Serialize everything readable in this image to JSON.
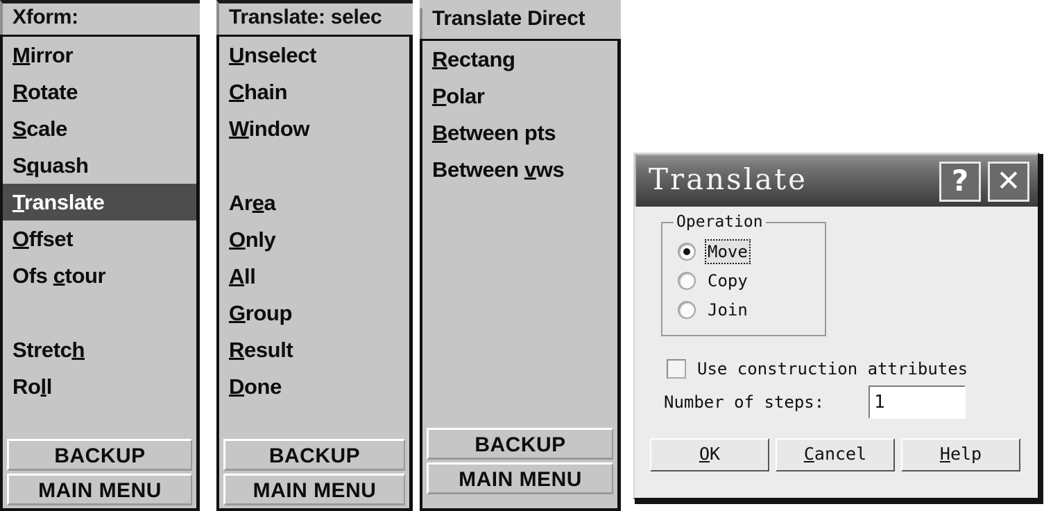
{
  "app": {
    "theme": {
      "panel_bg": "#c6c6c6",
      "panel_border": "#111111",
      "selection_bg": "#4d4d4d",
      "selection_fg": "#ffffff",
      "dialog_bg": "#ececec",
      "titlebar_dark": "#3b3b3b"
    }
  },
  "panels": [
    {
      "id": "xform-menu",
      "title": "Xform:",
      "items": [
        {
          "label": "Mirror",
          "pre": "",
          "accel": "M",
          "post": "irror",
          "selected": false
        },
        {
          "label": "Rotate",
          "pre": "",
          "accel": "R",
          "post": "otate",
          "selected": false
        },
        {
          "label": "Scale",
          "pre": "",
          "accel": "S",
          "post": "cale",
          "selected": false
        },
        {
          "label": "Squash",
          "pre": "S",
          "accel": "q",
          "post": "uash",
          "selected": false
        },
        {
          "label": "Translate",
          "pre": "",
          "accel": "T",
          "post": "ranslate",
          "selected": true
        },
        {
          "label": "Offset",
          "pre": "",
          "accel": "O",
          "post": "ffset",
          "selected": false
        },
        {
          "label": "Ofs ctour",
          "pre": "Ofs ",
          "accel": "c",
          "post": "tour",
          "selected": false
        },
        {
          "label": "",
          "spacer": true
        },
        {
          "label": "Stretch",
          "pre": "Stretc",
          "accel": "h",
          "post": "",
          "selected": false
        },
        {
          "label": "Roll",
          "pre": "Ro",
          "accel": "l",
          "post": "l",
          "selected": false
        }
      ],
      "footer": {
        "backup": "BACKUP",
        "main_menu": "MAIN MENU"
      }
    },
    {
      "id": "translate-select-menu",
      "title": "Translate: selec",
      "items": [
        {
          "label": "Unselect",
          "pre": "",
          "accel": "U",
          "post": "nselect",
          "selected": false
        },
        {
          "label": "Chain",
          "pre": "",
          "accel": "C",
          "post": "hain",
          "selected": false
        },
        {
          "label": "Window",
          "pre": "",
          "accel": "W",
          "post": "indow",
          "selected": false
        },
        {
          "label": "",
          "spacer": true
        },
        {
          "label": "Area",
          "pre": "Ar",
          "accel": "e",
          "post": "a",
          "selected": false
        },
        {
          "label": "Only",
          "pre": "",
          "accel": "O",
          "post": "nly",
          "selected": false
        },
        {
          "label": "All",
          "pre": "",
          "accel": "A",
          "post": "ll",
          "selected": false
        },
        {
          "label": "Group",
          "pre": "",
          "accel": "G",
          "post": "roup",
          "selected": false
        },
        {
          "label": "Result",
          "pre": "",
          "accel": "R",
          "post": "esult",
          "selected": false
        },
        {
          "label": "Done",
          "pre": "",
          "accel": "D",
          "post": "one",
          "selected": false
        }
      ],
      "footer": {
        "backup": "BACKUP",
        "main_menu": "MAIN MENU"
      }
    },
    {
      "id": "translate-direction-menu",
      "title": "Translate Direct",
      "items": [
        {
          "label": "Rectang",
          "pre": "",
          "accel": "R",
          "post": "ectang",
          "selected": false
        },
        {
          "label": "Polar",
          "pre": "",
          "accel": "P",
          "post": "olar",
          "selected": false
        },
        {
          "label": "Between pts",
          "pre": "",
          "accel": "B",
          "post": "etween pts",
          "selected": false
        },
        {
          "label": "Between vws",
          "pre": "Between ",
          "accel": "v",
          "post": "ws",
          "selected": false
        }
      ],
      "footer": {
        "backup": "BACKUP",
        "main_menu": "MAIN MENU"
      }
    }
  ],
  "dialog": {
    "title": "Translate",
    "help_glyph": "?",
    "close_glyph": "✕",
    "operation": {
      "legend": "Operation",
      "options": [
        {
          "label": "Move",
          "selected": true,
          "focused": true
        },
        {
          "label": "Copy",
          "selected": false,
          "focused": false
        },
        {
          "label": "Join",
          "selected": false,
          "focused": false
        }
      ]
    },
    "use_construction": {
      "label": "Use construction attributes",
      "checked": false
    },
    "steps": {
      "label": "Number of steps:",
      "value": "1"
    },
    "buttons": [
      {
        "pre": "",
        "accel": "O",
        "post": "K"
      },
      {
        "pre": "",
        "accel": "C",
        "post": "ancel"
      },
      {
        "pre": "",
        "accel": "H",
        "post": "elp"
      }
    ]
  }
}
